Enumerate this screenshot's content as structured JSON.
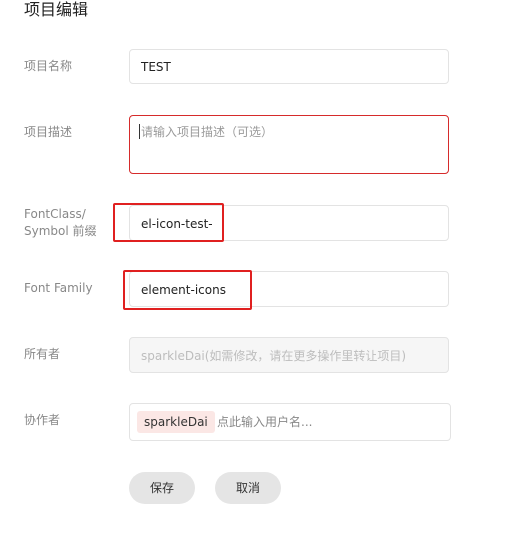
{
  "page": {
    "title": "项目编辑"
  },
  "form": {
    "name": {
      "label": "项目名称",
      "value": "TEST"
    },
    "description": {
      "label": "项目描述",
      "placeholder": "请输入项目描述（可选）"
    },
    "prefix": {
      "label_line1": "FontClass/",
      "label_line2": "Symbol 前缀",
      "value": "el-icon-test-"
    },
    "font_family": {
      "label": "Font Family",
      "value": "element-icons"
    },
    "owner": {
      "label": "所有者",
      "placeholder": "sparkleDai(如需修改，请在更多操作里转让项目)"
    },
    "collaborators": {
      "label": "协作者",
      "tags": [
        "sparkleDai"
      ],
      "placeholder": "点此输入用户名..."
    }
  },
  "actions": {
    "save_label": "保存",
    "cancel_label": "取消"
  },
  "colors": {
    "highlight_border": "#e02020",
    "tag_background": "#fbe7e5",
    "button_background": "#e5e5e5"
  }
}
